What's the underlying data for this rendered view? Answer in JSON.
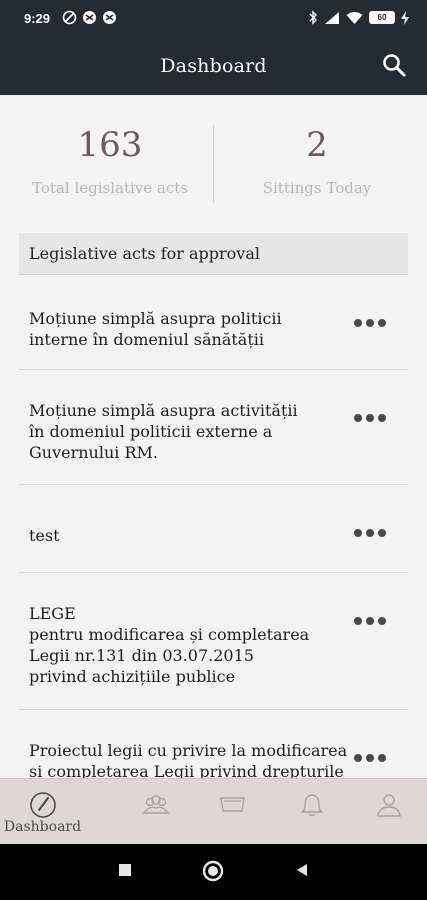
{
  "status_bar": {
    "time": "9:29",
    "battery": "60"
  },
  "app_bar": {
    "title": "Dashboard"
  },
  "stats": {
    "total_acts_value": "163",
    "total_acts_label": "Total legislative acts",
    "sittings_value": "2",
    "sittings_label": "Sittings Today"
  },
  "section": {
    "title": "Legislative acts for approval"
  },
  "acts": [
    {
      "title": "Moțiune simplă asupra politicii\ninterne în domeniul sănătății"
    },
    {
      "title": "Moțiune simplă asupra activității\nîn domeniul politicii externe a\nGuvernului RM."
    },
    {
      "title": "test"
    },
    {
      "title": "LEGE\npentru modificarea și completarea\nLegii nr.131 din 03.07.2015\n privind achizițiile publice"
    },
    {
      "title": "Proiectul legii cu privire la modificarea\nși completarea Legii privind drepturile"
    }
  ],
  "bottom_nav": {
    "items": [
      {
        "icon": "gauge-icon",
        "label": "Dashboard",
        "active": true
      },
      {
        "icon": "people-icon",
        "label": ""
      },
      {
        "icon": "documents-icon",
        "label": ""
      },
      {
        "icon": "bell-icon",
        "label": ""
      },
      {
        "icon": "person-icon",
        "label": ""
      }
    ]
  },
  "colors": {
    "app_bar": "#232c33",
    "background": "#f3f3f3",
    "stat_number": "#6b5a66",
    "bottom_nav": "#ddd8d6"
  }
}
